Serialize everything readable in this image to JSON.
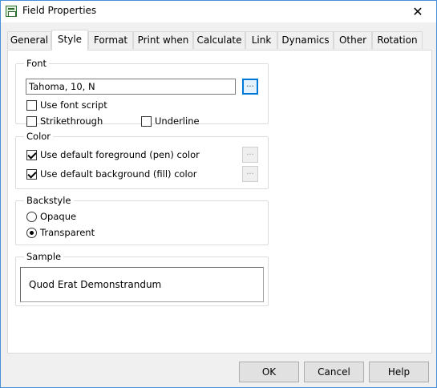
{
  "window": {
    "title": "Field Properties",
    "close_glyph": "✕"
  },
  "tabs": [
    {
      "label": "General"
    },
    {
      "label": "Style"
    },
    {
      "label": "Format"
    },
    {
      "label": "Print when"
    },
    {
      "label": "Calculate"
    },
    {
      "label": "Link"
    },
    {
      "label": "Dynamics"
    },
    {
      "label": "Other"
    },
    {
      "label": "Rotation"
    }
  ],
  "active_tab": "Style",
  "font_group": {
    "label": "Font",
    "font_value": "Tahoma, 10, N",
    "browse_label": "...",
    "use_font_script": {
      "label": "Use font script",
      "checked": false
    },
    "strikethrough": {
      "label": "Strikethrough",
      "checked": false
    },
    "underline": {
      "label": "Underline",
      "checked": false
    }
  },
  "color_group": {
    "label": "Color",
    "foreground": {
      "label": "Use default foreground (pen) color",
      "checked": true
    },
    "background": {
      "label": "Use default background (fill) color",
      "checked": true
    },
    "browse_label": "..."
  },
  "backstyle_group": {
    "label": "Backstyle",
    "opaque": {
      "label": "Opaque",
      "selected": false
    },
    "transparent": {
      "label": "Transparent",
      "selected": true
    }
  },
  "sample_group": {
    "label": "Sample",
    "text": "Quod Erat Demonstrandum"
  },
  "buttons": {
    "ok": "OK",
    "cancel": "Cancel",
    "help": "Help"
  },
  "colors": {
    "accent": "#0078d7",
    "window_border": "#4a90d9"
  }
}
